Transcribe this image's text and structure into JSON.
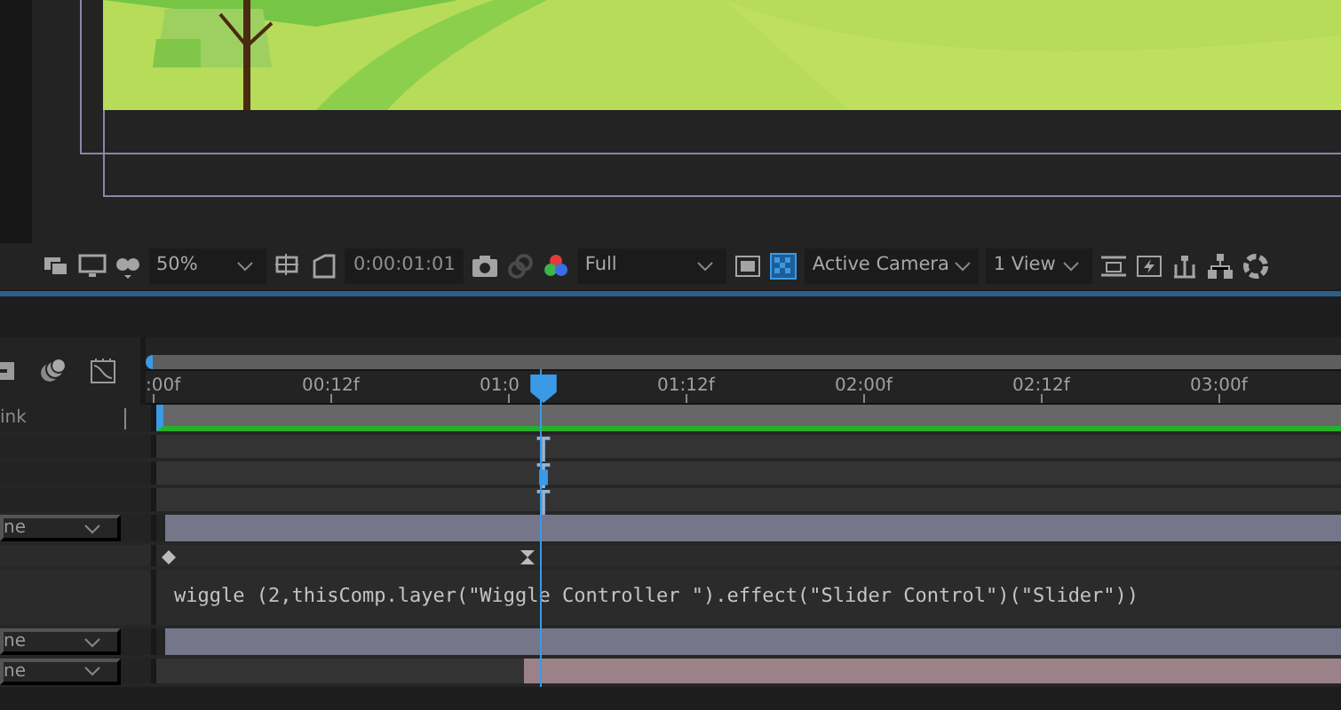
{
  "toolbar": {
    "zoom": "50%",
    "timecode": "0:00:01:01",
    "resolution": "Full",
    "transparency_grid": {
      "on": true
    },
    "view": "Active Camera",
    "layout": "1 View"
  },
  "timeline": {
    "ruler": [
      ":00f",
      "00:12f",
      "01:0",
      "01:12f",
      "02:00f",
      "02:12f",
      "03:00f"
    ],
    "layers": [
      {
        "kind": "track",
        "label": "ink"
      },
      {
        "kind": "property",
        "marked": false
      },
      {
        "kind": "property",
        "marked": true
      },
      {
        "kind": "property",
        "marked": false
      },
      {
        "kind": "layer",
        "label": "ne"
      },
      {
        "kind": "keys"
      },
      {
        "kind": "expression",
        "text": "wiggle (2,thisComp.layer(\"Wiggle Controller \").effect(\"Slider Control\")(\"Slider\"))"
      },
      {
        "kind": "layer",
        "label": "ne"
      },
      {
        "kind": "clip",
        "label": "ne",
        "level": 0.69
      }
    ]
  }
}
